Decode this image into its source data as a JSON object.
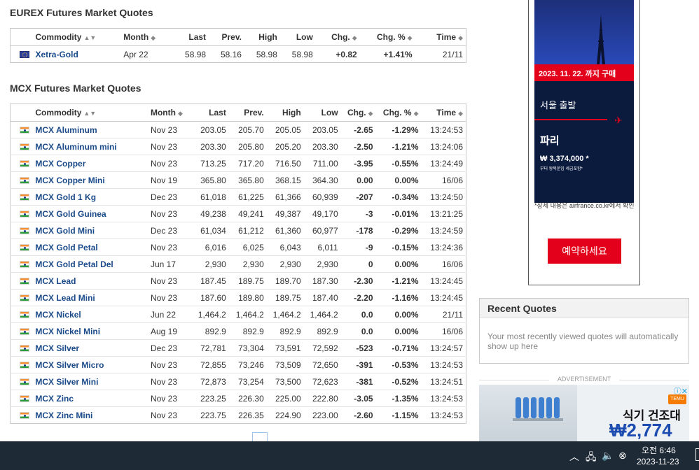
{
  "eurex": {
    "title": "EUREX Futures Market Quotes",
    "headers": {
      "commodity": "Commodity",
      "month": "Month",
      "last": "Last",
      "prev": "Prev.",
      "high": "High",
      "low": "Low",
      "chg": "Chg.",
      "chg_pct": "Chg. %",
      "time": "Time"
    },
    "rows": [
      {
        "name": "Xetra-Gold",
        "flag": "eu-flag-icon",
        "month": "Apr 22",
        "last": "58.98",
        "prev": "58.16",
        "high": "58.98",
        "low": "58.98",
        "chg": "+0.82",
        "chg_pct": "+1.41%",
        "time": "21/11",
        "dir": "up"
      }
    ]
  },
  "mcx": {
    "title": "MCX Futures Market Quotes",
    "headers": {
      "commodity": "Commodity",
      "month": "Month",
      "last": "Last",
      "prev": "Prev.",
      "high": "High",
      "low": "Low",
      "chg": "Chg.",
      "chg_pct": "Chg. %",
      "time": "Time"
    },
    "rows": [
      {
        "name": "MCX Aluminum",
        "month": "Nov 23",
        "last": "203.05",
        "prev": "205.70",
        "high": "205.05",
        "low": "203.05",
        "chg": "-2.65",
        "chg_pct": "-1.29%",
        "time": "13:24:53",
        "dir": "dn"
      },
      {
        "name": "MCX Aluminum mini",
        "month": "Nov 23",
        "last": "203.30",
        "prev": "205.80",
        "high": "205.20",
        "low": "203.30",
        "chg": "-2.50",
        "chg_pct": "-1.21%",
        "time": "13:24:06",
        "dir": "dn"
      },
      {
        "name": "MCX Copper",
        "month": "Nov 23",
        "last": "713.25",
        "prev": "717.20",
        "high": "716.50",
        "low": "711.00",
        "chg": "-3.95",
        "chg_pct": "-0.55%",
        "time": "13:24:49",
        "dir": "dn"
      },
      {
        "name": "MCX Copper Mini",
        "month": "Nov 19",
        "last": "365.80",
        "prev": "365.80",
        "high": "368.15",
        "low": "364.30",
        "chg": "0.00",
        "chg_pct": "0.00%",
        "time": "16/06",
        "dir": "nc"
      },
      {
        "name": "MCX Gold 1 Kg",
        "month": "Dec 23",
        "last": "61,018",
        "prev": "61,225",
        "high": "61,366",
        "low": "60,939",
        "chg": "-207",
        "chg_pct": "-0.34%",
        "time": "13:24:50",
        "dir": "dn"
      },
      {
        "name": "MCX Gold Guinea",
        "month": "Nov 23",
        "last": "49,238",
        "prev": "49,241",
        "high": "49,387",
        "low": "49,170",
        "chg": "-3",
        "chg_pct": "-0.01%",
        "time": "13:21:25",
        "dir": "dn"
      },
      {
        "name": "MCX Gold Mini",
        "month": "Dec 23",
        "last": "61,034",
        "prev": "61,212",
        "high": "61,360",
        "low": "60,977",
        "chg": "-178",
        "chg_pct": "-0.29%",
        "time": "13:24:59",
        "dir": "dn"
      },
      {
        "name": "MCX Gold Petal",
        "month": "Nov 23",
        "last": "6,016",
        "prev": "6,025",
        "high": "6,043",
        "low": "6,011",
        "chg": "-9",
        "chg_pct": "-0.15%",
        "time": "13:24:36",
        "dir": "dn"
      },
      {
        "name": "MCX Gold Petal Del",
        "month": "Jun 17",
        "last": "2,930",
        "prev": "2,930",
        "high": "2,930",
        "low": "2,930",
        "chg": "0",
        "chg_pct": "0.00%",
        "time": "16/06",
        "dir": "nc"
      },
      {
        "name": "MCX Lead",
        "month": "Nov 23",
        "last": "187.45",
        "prev": "189.75",
        "high": "189.70",
        "low": "187.30",
        "chg": "-2.30",
        "chg_pct": "-1.21%",
        "time": "13:24:45",
        "dir": "dn"
      },
      {
        "name": "MCX Lead Mini",
        "month": "Nov 23",
        "last": "187.60",
        "prev": "189.80",
        "high": "189.75",
        "low": "187.40",
        "chg": "-2.20",
        "chg_pct": "-1.16%",
        "time": "13:24:45",
        "dir": "dn"
      },
      {
        "name": "MCX Nickel",
        "month": "Jun 22",
        "last": "1,464.2",
        "prev": "1,464.2",
        "high": "1,464.2",
        "low": "1,464.2",
        "chg": "0.0",
        "chg_pct": "0.00%",
        "time": "21/11",
        "dir": "nc"
      },
      {
        "name": "MCX Nickel Mini",
        "month": "Aug 19",
        "last": "892.9",
        "prev": "892.9",
        "high": "892.9",
        "low": "892.9",
        "chg": "0.0",
        "chg_pct": "0.00%",
        "time": "16/06",
        "dir": "nc"
      },
      {
        "name": "MCX Silver",
        "month": "Dec 23",
        "last": "72,781",
        "prev": "73,304",
        "high": "73,591",
        "low": "72,592",
        "chg": "-523",
        "chg_pct": "-0.71%",
        "time": "13:24:57",
        "dir": "dn"
      },
      {
        "name": "MCX Silver Micro",
        "month": "Nov 23",
        "last": "72,855",
        "prev": "73,246",
        "high": "73,509",
        "low": "72,650",
        "chg": "-391",
        "chg_pct": "-0.53%",
        "time": "13:24:53",
        "dir": "dn"
      },
      {
        "name": "MCX Silver Mini",
        "month": "Nov 23",
        "last": "72,873",
        "prev": "73,254",
        "high": "73,500",
        "low": "72,623",
        "chg": "-381",
        "chg_pct": "-0.52%",
        "time": "13:24:51",
        "dir": "dn"
      },
      {
        "name": "MCX Zinc",
        "month": "Nov 23",
        "last": "223.25",
        "prev": "226.30",
        "high": "225.00",
        "low": "222.80",
        "chg": "-3.05",
        "chg_pct": "-1.35%",
        "time": "13:24:53",
        "dir": "dn"
      },
      {
        "name": "MCX Zinc Mini",
        "month": "Nov 23",
        "last": "223.75",
        "prev": "226.35",
        "high": "224.90",
        "low": "223.00",
        "chg": "-2.60",
        "chg_pct": "-1.15%",
        "time": "13:24:53",
        "dir": "dn"
      }
    ]
  },
  "ad_top": {
    "date_band": "2023. 11. 22. 까지 구매",
    "departure": "서울 출발",
    "destination": "파리",
    "price": "₩ 3,374,000 *",
    "price_note": "부터 왕복운임 세금포함*",
    "fine_print": "*상세 내용은 airfrance.co.kr에서 확인",
    "cta": "예약하세요",
    "accent_color": "#e2001a"
  },
  "recent": {
    "title": "Recent Quotes",
    "message": "Your most recently viewed quotes will automatically show up here"
  },
  "advertisement_label": "ADVERTISEMENT",
  "ad_bottom": {
    "headline": "식기 건조대",
    "price": "₩2,774",
    "badge": "TEMU"
  },
  "taskbar": {
    "time": "오전 6:46",
    "date": "2023-11-23"
  },
  "colors": {
    "up": "#1a9b1a",
    "down": "#e01010",
    "link": "#1a4a8a",
    "taskbar": "#1f2a37"
  }
}
